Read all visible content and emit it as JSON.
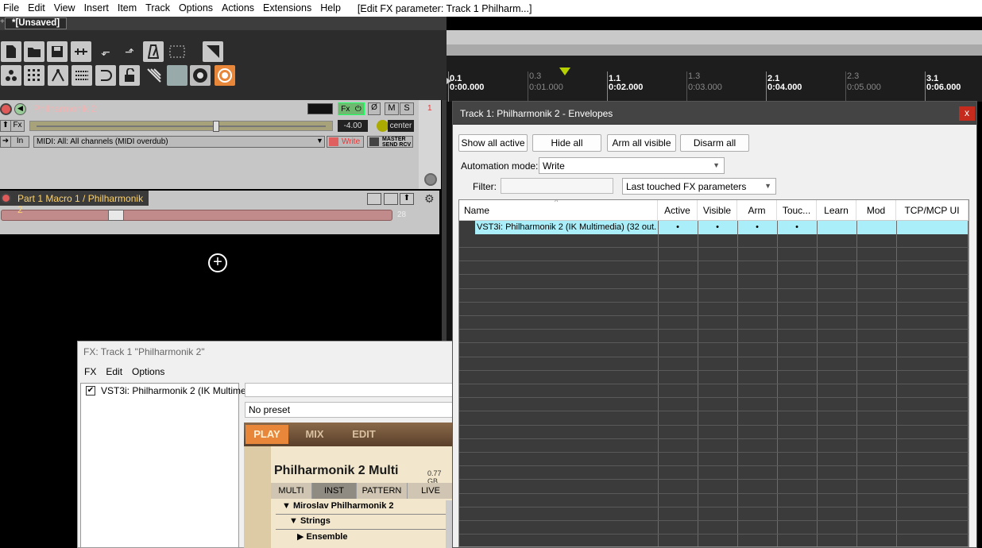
{
  "menubar": {
    "items": [
      "File",
      "Edit",
      "View",
      "Insert",
      "Item",
      "Track",
      "Options",
      "Actions",
      "Extensions",
      "Help"
    ],
    "title": "[Edit FX parameter: Track 1 Philharm...]"
  },
  "project_tab": {
    "label": "*[Unsaved]"
  },
  "ruler": {
    "marks": [
      {
        "bar": "0.1",
        "time": "0:00.000",
        "dim": false
      },
      {
        "bar": "0.3",
        "time": "0:01.000",
        "dim": true
      },
      {
        "bar": "1.1",
        "time": "0:02.000",
        "dim": false
      },
      {
        "bar": "1.3",
        "time": "0:03.000",
        "dim": true
      },
      {
        "bar": "2.1",
        "time": "0:04.000",
        "dim": false
      },
      {
        "bar": "2.3",
        "time": "0:05.000",
        "dim": true
      },
      {
        "bar": "3.1",
        "time": "0:06.000",
        "dim": false
      }
    ]
  },
  "track": {
    "number": "1",
    "name": "Philharmonik 2",
    "fx_label": "Fx",
    "volume": "-4.00",
    "pan": "center",
    "input_label": "In",
    "input_value": "MIDI: All: All channels (MIDI overdub)",
    "automation_label": "Write",
    "m_label": "M",
    "s_label": "S",
    "master_label": "MASTER",
    "send_label": "SEND RCV"
  },
  "env_lane": {
    "name": "Part 1 Macro 1 / Philharmonik 2",
    "value": "28"
  },
  "fx_window": {
    "title": "FX: Track 1 \"Philharmonik 2\"",
    "menu": [
      "FX",
      "Edit",
      "Options"
    ],
    "plugin_item": "VST3i: Philharmonik 2 (IK Multime...",
    "preset": "No preset",
    "plugin_tabs": [
      "PLAY",
      "MIX",
      "EDIT"
    ],
    "product_name": "Philharmonik 2 Multi",
    "size_label": "0.77 GB",
    "subtabs": [
      "MULTI",
      "INST",
      "PATTERN",
      "LIVE"
    ],
    "tree": [
      "Miroslav Philharmonik 2",
      "Strings",
      "Ensemble"
    ]
  },
  "env_window": {
    "title": "Track 1: Philharmonik 2 - Envelopes",
    "close_label": "x",
    "buttons": [
      "Show all active",
      "Hide all",
      "Arm all visible",
      "Disarm all"
    ],
    "automation_mode_label": "Automation mode:",
    "automation_mode_value": "Write",
    "filter_label": "Filter:",
    "filter_value": "",
    "filter_type": "Last touched FX parameters",
    "columns": [
      "Name",
      "Active",
      "Visible",
      "Arm",
      "Touc...",
      "Learn",
      "Mod",
      "TCP/MCP UI"
    ],
    "row": {
      "name": "VST3i: Philharmonik 2 (IK Multimedia) (32 out...",
      "active": "•",
      "visible": "•",
      "arm": "•",
      "touch": "•"
    }
  },
  "colors": {
    "accent_orange": "#e8863a",
    "row_highlight": "#a9eef8",
    "track_panel": "#c6c6c6"
  }
}
